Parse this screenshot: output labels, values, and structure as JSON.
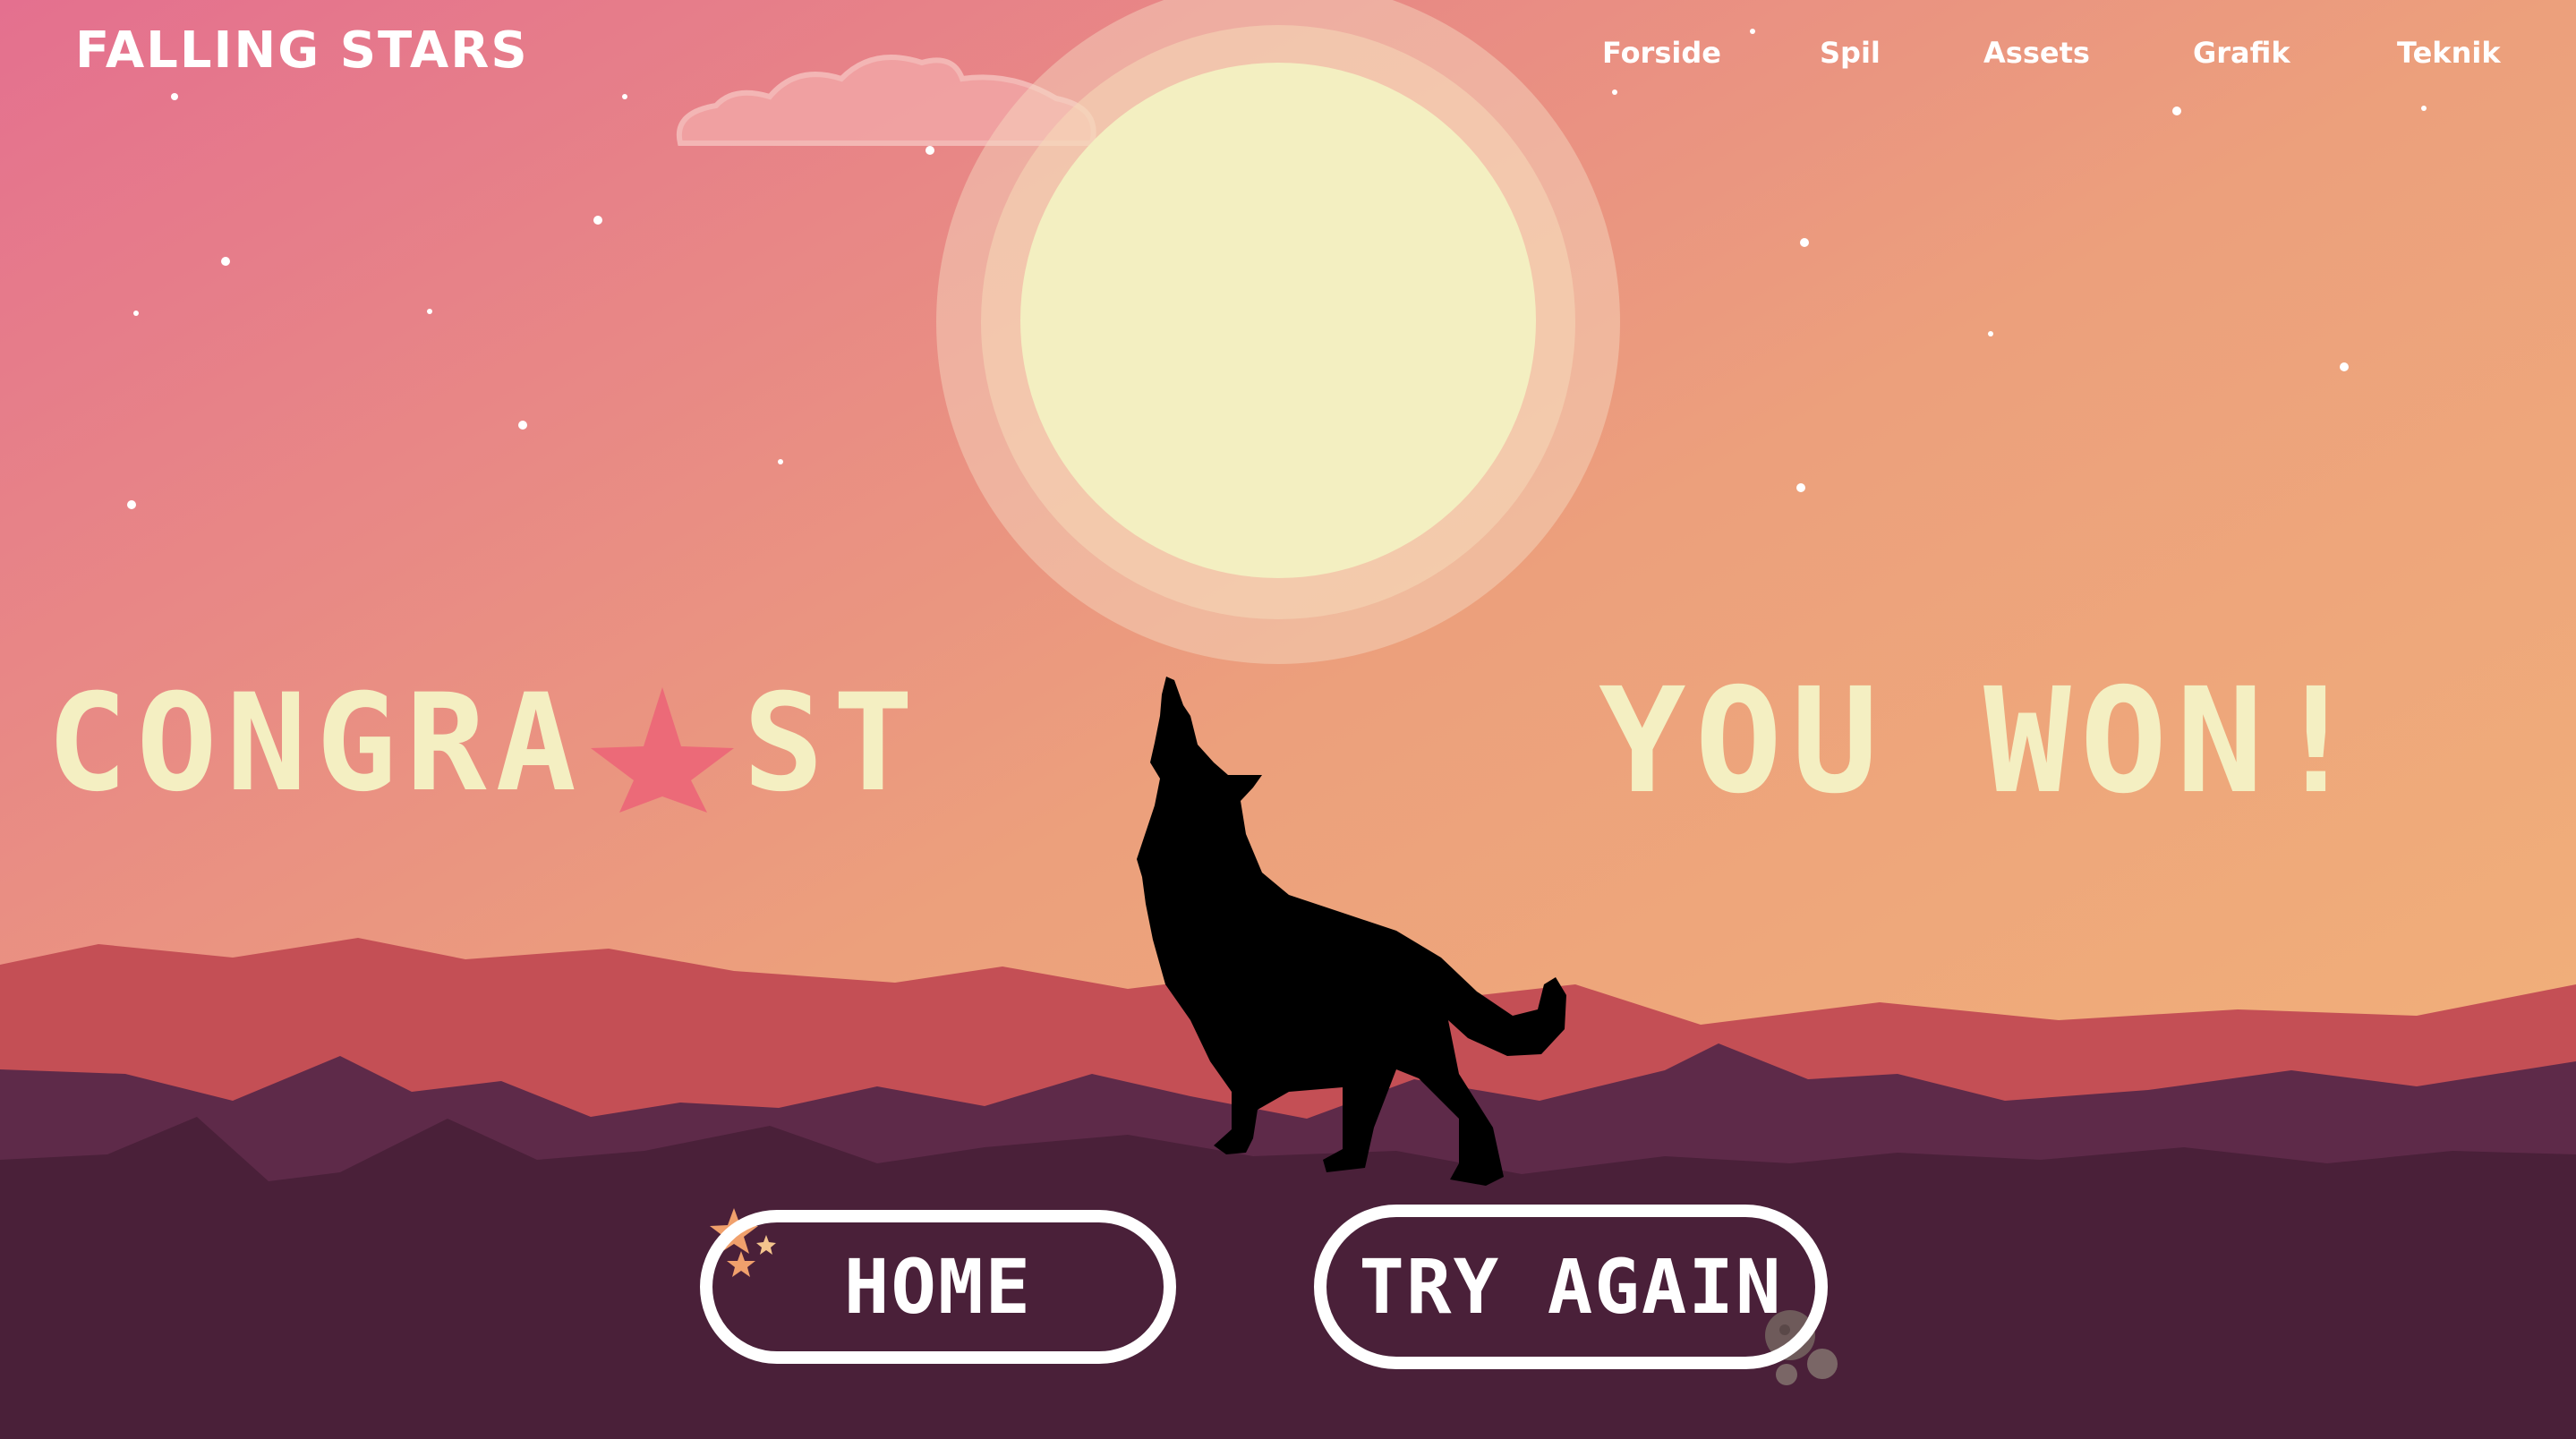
{
  "brand": {
    "title": "FALLING STARS"
  },
  "nav": {
    "items": [
      "Forside",
      "Spil",
      "Assets",
      "Grafik",
      "Teknik"
    ]
  },
  "headline": {
    "left": "CONGRA",
    "left_after_star": "ST",
    "right": "YOU WON!"
  },
  "buttons": {
    "home": "HOME",
    "try_again": "TRY AGAIN"
  },
  "colors": {
    "sky_top": "#e4708f",
    "sky_bottom": "#f2b479",
    "moon": "#f3efc1",
    "headline_text": "#f4efc2",
    "star_accent": "#ec6a78",
    "mountain_far": "#c44f55",
    "mountain_mid": "#5e2a49",
    "ground": "#4a2039",
    "button_outline": "#ffffff"
  },
  "icons": [
    "cloud-icon",
    "moon-icon",
    "wolf-silhouette-icon",
    "star-icon",
    "small-stars-icon",
    "rocks-icon"
  ]
}
